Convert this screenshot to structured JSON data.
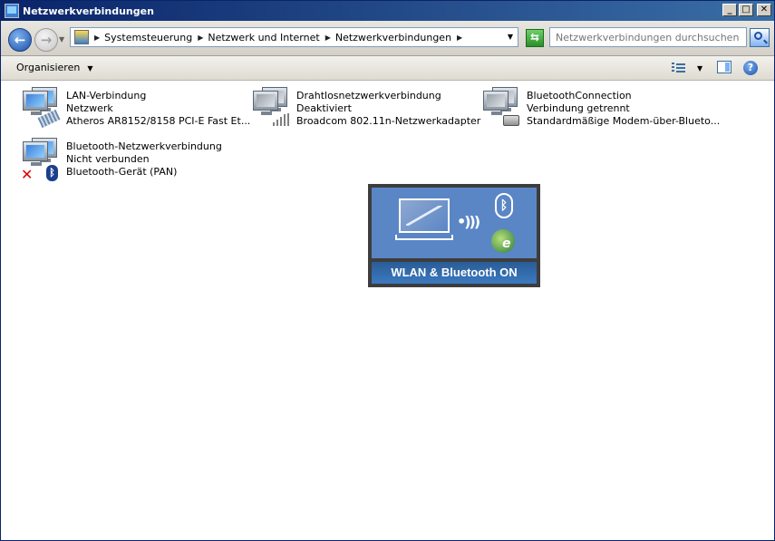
{
  "window": {
    "title": "Netzwerkverbindungen"
  },
  "title_buttons": {
    "minimize": "_",
    "maximize": "□",
    "close": "✕"
  },
  "address": {
    "crumbs": [
      "Systemsteuerung",
      "Netzwerk und Internet",
      "Netzwerkverbindungen"
    ],
    "search_placeholder": "Netzwerkverbindungen durchsuchen"
  },
  "nav": {
    "back": "←",
    "forward": "→",
    "refresh": "⇆"
  },
  "toolbar": {
    "organize_label": "Organisieren",
    "help": "?"
  },
  "connections": [
    {
      "name": "LAN-Verbindung",
      "status": "Netzwerk",
      "device": "Atheros AR8152/8158 PCI-E Fast Et...",
      "icon": "lan-icon"
    },
    {
      "name": "Drahtlosnetzwerkverbindung",
      "status": "Deaktiviert",
      "device": "Broadcom 802.11n-Netzwerkadapter",
      "icon": "wireless-icon"
    },
    {
      "name": "BluetoothConnection",
      "status": "Verbindung getrennt",
      "device": "Standardmäßige Modem-über-Blueto...",
      "icon": "modem-icon"
    },
    {
      "name": "Bluetooth-Netzwerkverbindung",
      "status": "Nicht verbunden",
      "device": "Bluetooth-Gerät (PAN)",
      "icon": "bluetooth-icon"
    }
  ],
  "overlay": {
    "label": "WLAN & Bluetooth ON"
  }
}
